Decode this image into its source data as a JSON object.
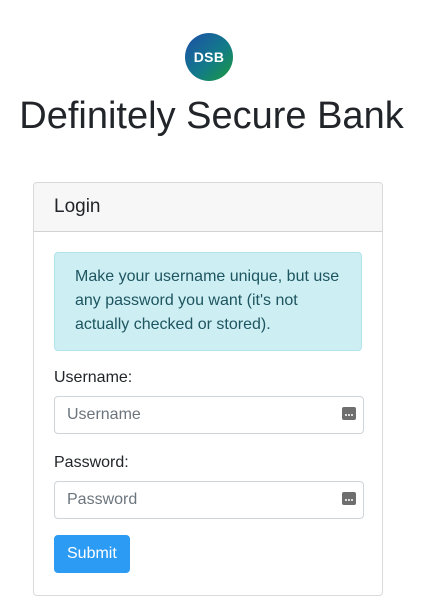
{
  "brand": {
    "logo_text": "DSB",
    "title": "Definitely Secure Bank"
  },
  "login_card": {
    "header": "Login",
    "notice": "Make your username unique, but use any password you want (it's not actually checked or stored).",
    "username": {
      "label": "Username:",
      "placeholder": "Username",
      "value": ""
    },
    "password": {
      "label": "Password:",
      "placeholder": "Password",
      "value": ""
    },
    "submit_label": "Submit"
  },
  "icons": {
    "username_field_icon": "password-manager-key-icon",
    "password_field_icon": "password-manager-key-icon"
  },
  "colors": {
    "primary_button": "#2b9bf4",
    "info_alert_bg": "#cdeef2",
    "info_alert_text": "#1d5560"
  }
}
